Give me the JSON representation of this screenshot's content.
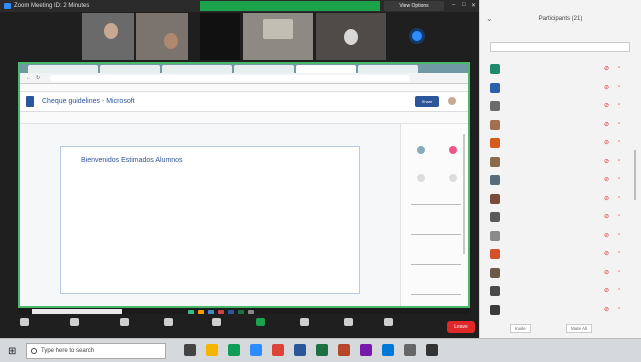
{
  "zoom": {
    "title": "Zoom Meeting ID: 2 Minutes",
    "view_options": "View Options",
    "window_controls": [
      "–",
      "□",
      "✕"
    ],
    "video_tiles": [
      "",
      "",
      "",
      "",
      ""
    ]
  },
  "browser": {
    "tabs": [
      "",
      "",
      "",
      "",
      "",
      ""
    ],
    "url": "",
    "bookmarks": ""
  },
  "document": {
    "title": "Cheque guidelines - Microsoft",
    "share": "Share",
    "toolbar": "",
    "heading": "Bienvenidos Estimados Alumnos",
    "lines": [
      "",
      "",
      "",
      "",
      "",
      "",
      "",
      "",
      "",
      "",
      ""
    ],
    "side_tabs": [
      "",
      "",
      ""
    ]
  },
  "shared_taskbar": {
    "search": ""
  },
  "zoom_controls": {
    "buttons": [
      {
        "icon": "microphone-icon",
        "label": ""
      },
      {
        "icon": "video-icon",
        "label": ""
      },
      {
        "icon": "security-icon",
        "label": ""
      },
      {
        "icon": "participants-icon",
        "label": ""
      },
      {
        "icon": "chat-icon",
        "label": ""
      },
      {
        "icon": "share-screen-icon",
        "label": ""
      },
      {
        "icon": "record-icon",
        "label": ""
      },
      {
        "icon": "reactions-icon",
        "label": ""
      },
      {
        "icon": "apps-icon",
        "label": ""
      }
    ],
    "leave": "Leave"
  },
  "participants": {
    "title": "Participants (21)",
    "search": "",
    "people": [
      {
        "name": "",
        "color": "#1f8a6b"
      },
      {
        "name": "",
        "color": "#2b5eab"
      },
      {
        "name": "",
        "color": "#6b6b6b"
      },
      {
        "name": "",
        "color": "#a07050"
      },
      {
        "name": "",
        "color": "#d65a1c"
      },
      {
        "name": "",
        "color": "#8a6a4a"
      },
      {
        "name": "",
        "color": "#556b7a"
      },
      {
        "name": "",
        "color": "#7a4a3a"
      },
      {
        "name": "",
        "color": "#5a5a5a"
      },
      {
        "name": "",
        "color": "#8a8a8a"
      },
      {
        "name": "",
        "color": "#d6502a"
      },
      {
        "name": "",
        "color": "#6a5a4a"
      },
      {
        "name": "",
        "color": "#4a4a4a"
      },
      {
        "name": "",
        "color": "#3a3a3a"
      }
    ],
    "invite": "Invite",
    "mute_all": "Mute All"
  },
  "windows": {
    "search_placeholder": "Type here to search",
    "time": ""
  }
}
